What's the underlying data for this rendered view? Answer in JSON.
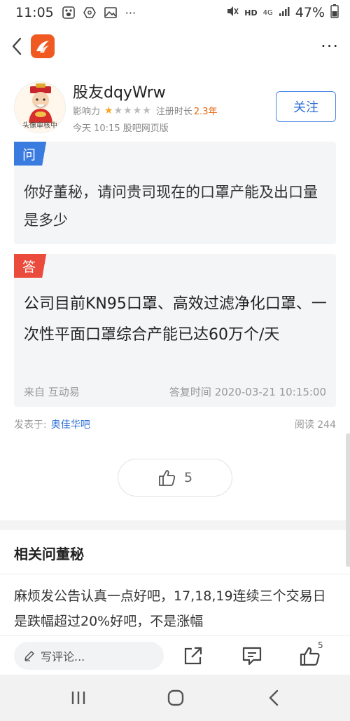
{
  "status_bar": {
    "time": "11:05",
    "network": "HD",
    "cell": "4G",
    "battery": "47%"
  },
  "nav": {
    "more_label": "···"
  },
  "author": {
    "name": "股友dqyWrw",
    "avatar_caption": "头像审核中",
    "influence_label": "影响力",
    "stars": 1,
    "stars_total": 5,
    "reg_label": "注册时长",
    "reg_years": "2.3年",
    "post_time": "今天 10:15 股吧网页版",
    "follow_label": "关注"
  },
  "question": {
    "tag": "问",
    "text": "你好董秘，请问贵司现在的口罩产能及出口量是多少"
  },
  "answer": {
    "tag": "答",
    "text": "公司目前KN95口罩、高效过滤净化口罩、一次性平面口罩综合产能已达60万个/天",
    "source": "来自 互动易",
    "time": "答复时间 2020-03-21 10:15:00"
  },
  "post_meta": {
    "posted_in_label": "发表于:",
    "bar_name": "奥佳华吧",
    "reads": "阅读 244"
  },
  "like": {
    "count": "5"
  },
  "related": {
    "title": "相关问董秘",
    "items": [
      "麻烦发公告认真一点好吧，17,18,19连续三个交易日是跌幅超过20%好吧，不是涨幅"
    ]
  },
  "action_bar": {
    "comment_placeholder": "写评论...",
    "like_count": "5"
  },
  "colors": {
    "accent_blue": "#2d6fd6",
    "tag_question": "#3a7be0",
    "tag_answer": "#ea4b3c",
    "logo_orange": "#f05a22",
    "star_on": "#f5a623"
  }
}
